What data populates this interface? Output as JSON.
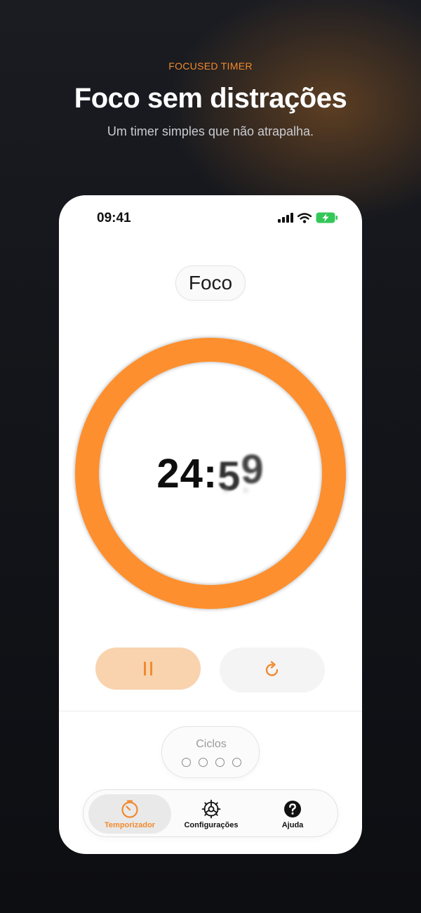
{
  "hero": {
    "kicker": "FOCUSED TIMER",
    "headline": "Foco sem distrações",
    "subline": "Um timer simples que não atrapalha."
  },
  "status_bar": {
    "time": "09:41",
    "icons": [
      "cellular-signal-icon",
      "wifi-icon",
      "battery-charging-icon"
    ]
  },
  "mode": {
    "label": "Foco"
  },
  "timer": {
    "minutes": "24",
    "separator": ":",
    "seconds_tens": "5",
    "seconds_units": "9",
    "progress": 1.0
  },
  "controls": {
    "pause_icon": "pause-icon",
    "reset_icon": "restart-icon"
  },
  "cycles": {
    "label": "Ciclos",
    "total": 4,
    "completed": 0
  },
  "tabs": [
    {
      "label": "Temporizador",
      "icon": "stopwatch-icon",
      "active": true
    },
    {
      "label": "Configurações",
      "icon": "gear-icon",
      "active": false
    },
    {
      "label": "Ajuda",
      "icon": "help-icon",
      "active": false
    }
  ],
  "colors": {
    "accent": "#f28a2e",
    "ring": "#fd8f2e",
    "pause_bg": "#f8d3ae",
    "battery": "#34c759"
  }
}
